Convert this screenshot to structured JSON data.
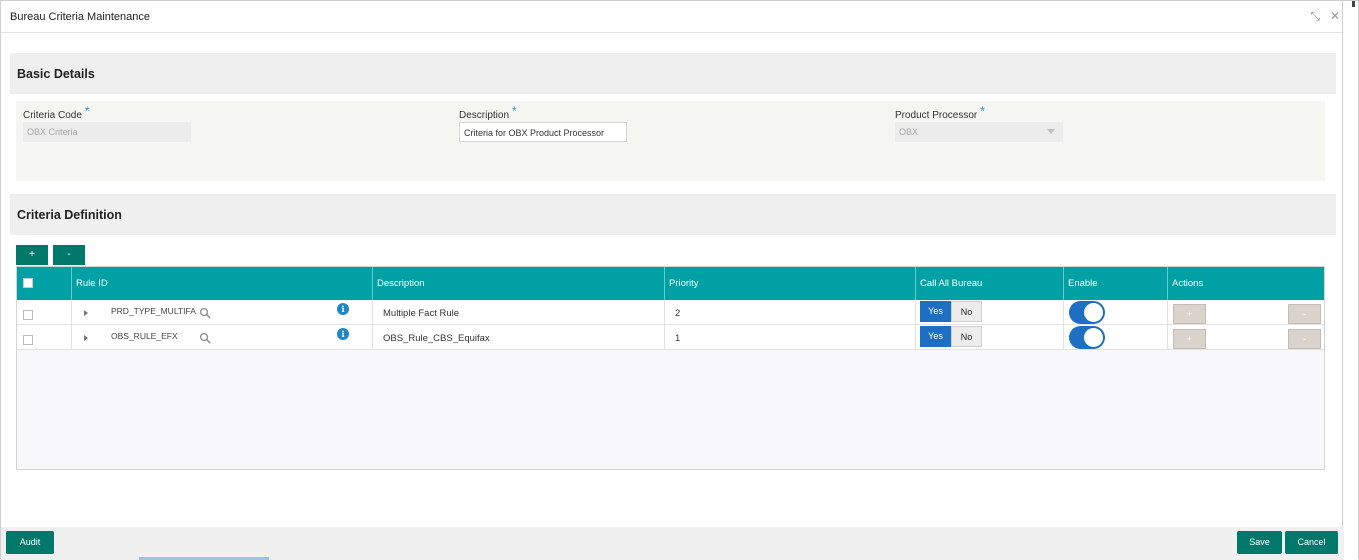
{
  "window": {
    "title": "Bureau Criteria Maintenance"
  },
  "basic_details": {
    "heading": "Basic Details",
    "criteria_code": {
      "label": "Criteria Code",
      "required_mark": "*",
      "value": "OBX Criteria"
    },
    "description": {
      "label": "Description",
      "required_mark": "*",
      "value": "Criteria for OBX Product Processor"
    },
    "product_processor": {
      "label": "Product Processor",
      "required_mark": "*",
      "value": "OBX"
    }
  },
  "criteria_definition": {
    "heading": "Criteria Definition",
    "add_label": "+",
    "remove_label": "-",
    "columns": [
      "Rule ID",
      "Description",
      "Priority",
      "Call All Bureau",
      "Enable",
      "Actions"
    ],
    "rows": [
      {
        "rule_id": "PRD_TYPE_MULTIFA",
        "description": "Multiple Fact Rule",
        "priority": "2",
        "call_all_bureau": "Yes",
        "enabled": true
      },
      {
        "rule_id": "OBS_RULE_EFX",
        "description": "OBS_Rule_CBS_Equifax",
        "priority": "1",
        "call_all_bureau": "Yes",
        "enabled": true
      }
    ],
    "yes_label": "Yes",
    "no_label": "No",
    "action_add": "+",
    "action_remove": "-",
    "info_glyph": "i"
  },
  "footer": {
    "audit": "Audit",
    "save": "Save",
    "cancel": "Cancel"
  },
  "icons": {
    "minimize": "compress-icon",
    "close": "close-icon",
    "search": "search-icon",
    "info": "info-icon"
  },
  "colors": {
    "teal": "#00a0a5",
    "button_teal": "#00796b",
    "toggle_blue": "#1d6fc3"
  }
}
